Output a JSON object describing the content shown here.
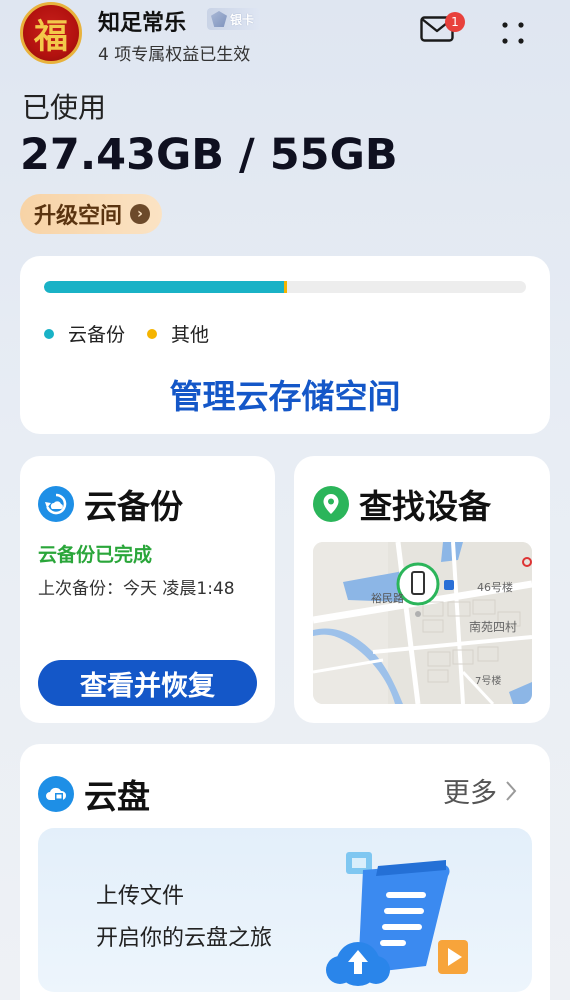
{
  "header": {
    "avatar_char": "福",
    "username": "知足常乐",
    "badge": "银卡",
    "subtitle": "4 项专属权益已生效",
    "mail_count": "1"
  },
  "usage": {
    "label": "已使用",
    "value": "27.43GB / 55GB",
    "upgrade_label": "升级空间",
    "used_fraction": 0.4987,
    "cloud_fraction": 0.4987,
    "other_fraction": 0.005
  },
  "storage": {
    "legend": [
      {
        "label": "云备份",
        "color": "#19b2c6"
      },
      {
        "label": "其他",
        "color": "#f5b400"
      }
    ],
    "manage_label": "管理云存储空间"
  },
  "backup": {
    "title": "云备份",
    "status": "云备份已完成",
    "last_backup": "上次备份：今天 凌晨1:48",
    "button": "查看并恢复"
  },
  "find": {
    "title": "查找设备",
    "map_labels": {
      "road": "裕民路",
      "building": "46号楼",
      "village": "南苑四村",
      "building2": "7号楼"
    }
  },
  "disk": {
    "title": "云盘",
    "more": "更多",
    "upload_line1": "上传文件",
    "upload_line2": "开启你的云盘之旅"
  }
}
